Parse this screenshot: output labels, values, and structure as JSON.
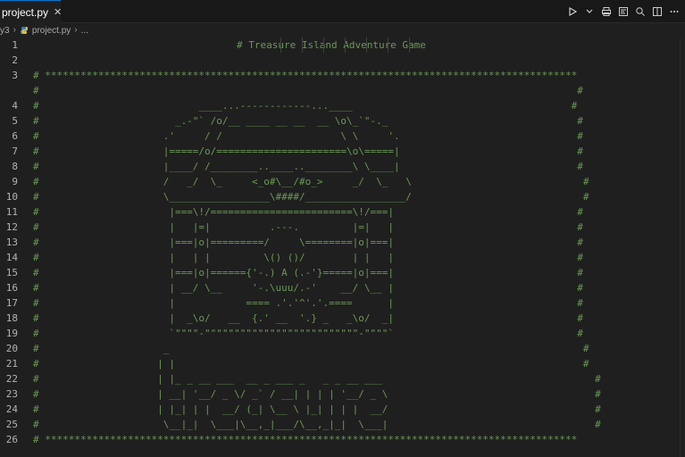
{
  "tab": {
    "label": "project.py",
    "close": "✕"
  },
  "breadcrumbs": {
    "folder": "y3",
    "file": "project.py",
    "symbol": "..."
  },
  "toolbar": {
    "run_icon": "play-icon",
    "dropdown_icon": "chevron-down-icon",
    "print_icon": "print-icon",
    "preview_icon": "preview-icon",
    "search_icon": "search-icon",
    "split_icon": "split-editor-icon",
    "more_icon": "more-icon"
  },
  "editor": {
    "lines": [
      {
        "number": "1",
        "text": "# Treasure Island Adventure Game"
      },
      {
        "number": "2",
        "text": ""
      },
      {
        "number": "3",
        "text": "# ******************************************************************************************"
      },
      {
        "number": "",
        "text": "#                                                                                           #"
      },
      {
        "number": "4",
        "text": "#                           ____...------------...____                                     #"
      },
      {
        "number": "5",
        "text": "#                       _.-\"` /o/__ ____ __ __  __ \\o\\_`\"-._                                #"
      },
      {
        "number": "6",
        "text": "#                     .'     / /                    \\ \\     '.                              #"
      },
      {
        "number": "7",
        "text": "#                     |=====/o/======================\\o\\=====|                              #"
      },
      {
        "number": "8",
        "text": "#                     |____/ /________..____..________\\ \\____|                              #"
      },
      {
        "number": "9",
        "text": "#                     /   _/  \\_     <_o#\\__/#o_>     _/  \\_   \\                             #"
      },
      {
        "number": "10",
        "text": "#                     \\_________________\\####/_________________/                             #"
      },
      {
        "number": "11",
        "text": "#                      |===\\!/========================\\!/===|                               #"
      },
      {
        "number": "12",
        "text": "#                      |   |=|          .---.         |=|   |                               #"
      },
      {
        "number": "13",
        "text": "#                      |===|o|=========/     \\========|o|===|                               #"
      },
      {
        "number": "14",
        "text": "#                      |   | |         \\() ()/        | |   |                               #"
      },
      {
        "number": "15",
        "text": "#                      |===|o|======{'-.) A (.-'}=====|o|===|                               #"
      },
      {
        "number": "16",
        "text": "#                      | __/ \\__     '-.\\uuu/.-'    __/ \\__ |                               #"
      },
      {
        "number": "17",
        "text": "#                      |            ==== .'.'^'.'.====      |                               #"
      },
      {
        "number": "18",
        "text": "#                      |  _\\o/   __  {.' __  '.} _   _\\o/  _|                               #"
      },
      {
        "number": "19",
        "text": "#                      `\"\"\"\"-\"\"\"\"\"\"\"\"\"\"\"\"\"\"\"\"\"\"\"\"\"\"\"\"\"\"-\"\"\"\"`                               #"
      },
      {
        "number": "20",
        "text": "#                     _                                                                      #"
      },
      {
        "number": "21",
        "text": "#                    | |                                                                     #"
      },
      {
        "number": "22",
        "text": "#                    | |_ _ __ ___  __ _ ___ _   _ _ __ ___                                    #"
      },
      {
        "number": "23",
        "text": "#                    | __| '__/ _ \\/ _` / __| | | | '__/ _ \\                                   #"
      },
      {
        "number": "24",
        "text": "#                    | |_| | |  __/ (_| \\__ \\ |_| | | |  __/                                   #"
      },
      {
        "number": "25",
        "text": "#                     \\__|_|  \\___|\\__,_|___/\\__,_|_|  \\___|                                   #"
      },
      {
        "number": "26",
        "text": "# ******************************************************************************************"
      }
    ]
  }
}
